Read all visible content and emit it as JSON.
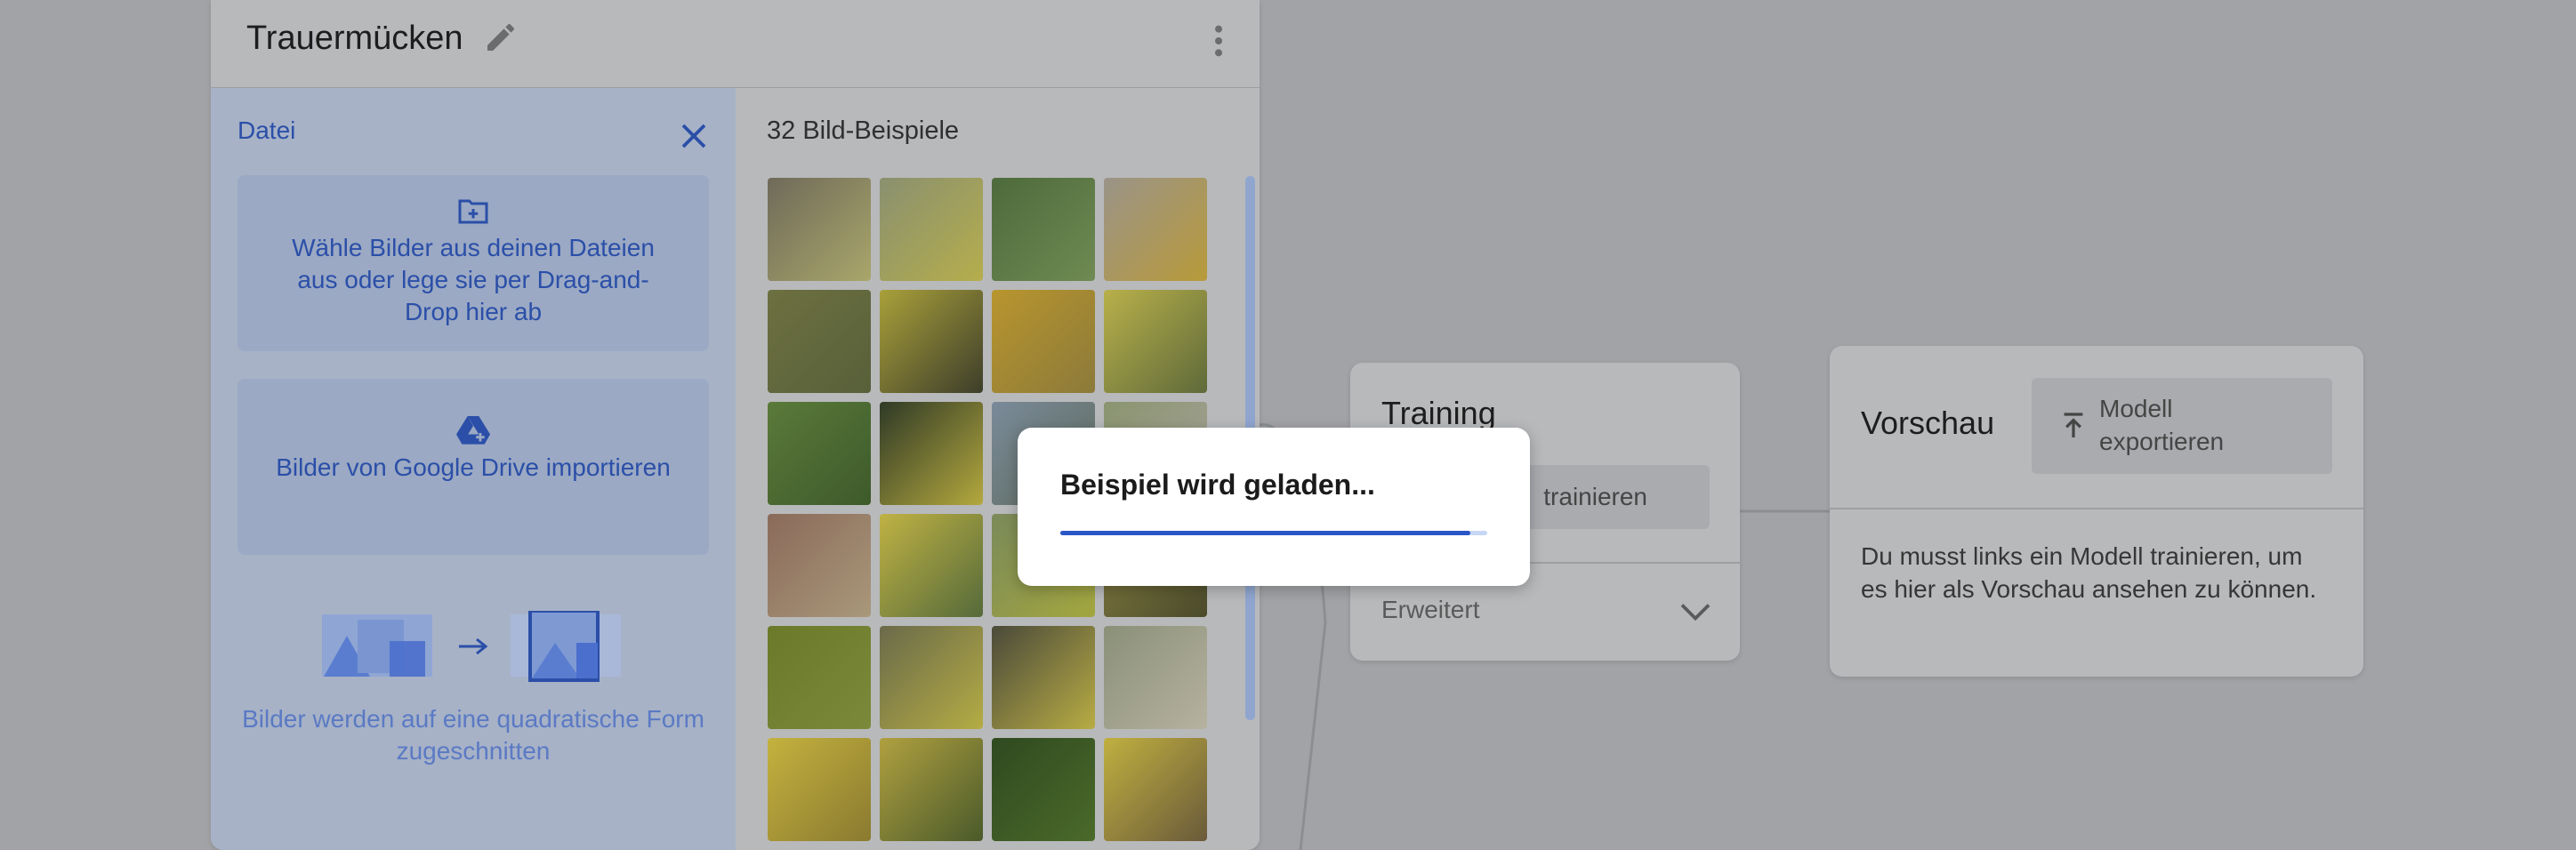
{
  "class_card": {
    "title": "Trauermücken",
    "upload": {
      "title": "Datei",
      "file_button": "Wähle Bilder aus deinen Dateien aus oder lege sie per Drag-and-Drop hier ab",
      "drive_button": "Bilder von Google Drive importieren",
      "crop_note": "Bilder werden auf eine quadratische Form zugeschnitten"
    },
    "gallery": {
      "title": "32 Bild-Beispiele",
      "thumb_count": 24
    }
  },
  "training": {
    "title": "Training",
    "train_button": "trainieren",
    "advanced": "Erweitert"
  },
  "preview": {
    "title": "Vorschau",
    "export_button": "Modell exportieren",
    "description": "Du musst links ein Modell trainieren, um es hier als Vorschau ansehen zu können."
  },
  "modal": {
    "text": "Beispiel wird geladen...",
    "progress": 0.96
  },
  "colors": {
    "accent": "#2a56c6",
    "overlay": "#a2a3a6"
  }
}
